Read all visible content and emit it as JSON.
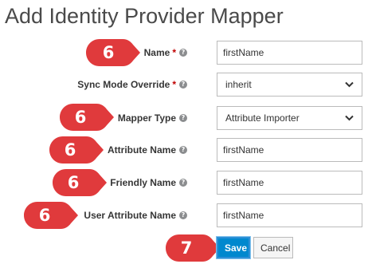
{
  "page": {
    "title": "Add Identity Provider Mapper"
  },
  "form": {
    "name": {
      "label": "Name",
      "required_mark": "*",
      "value": "firstName"
    },
    "sync_mode_override": {
      "label": "Sync Mode Override",
      "required_mark": "*",
      "selected": "inherit"
    },
    "mapper_type": {
      "label": "Mapper Type",
      "selected": "Attribute Importer"
    },
    "attribute_name": {
      "label": "Attribute Name",
      "value": "firstName"
    },
    "friendly_name": {
      "label": "Friendly Name",
      "value": "firstName"
    },
    "user_attribute_name": {
      "label": "User Attribute Name",
      "value": "firstName"
    }
  },
  "help_icon": {
    "name": "help-icon",
    "glyph": "?"
  },
  "actions": {
    "save_label": "Save",
    "cancel_label": "Cancel"
  },
  "callouts": {
    "step_fields": "6",
    "step_save": "7"
  },
  "colors": {
    "callout_red": "#e03a3c",
    "primary_blue": "#0088ce",
    "required_red": "#c00000"
  }
}
